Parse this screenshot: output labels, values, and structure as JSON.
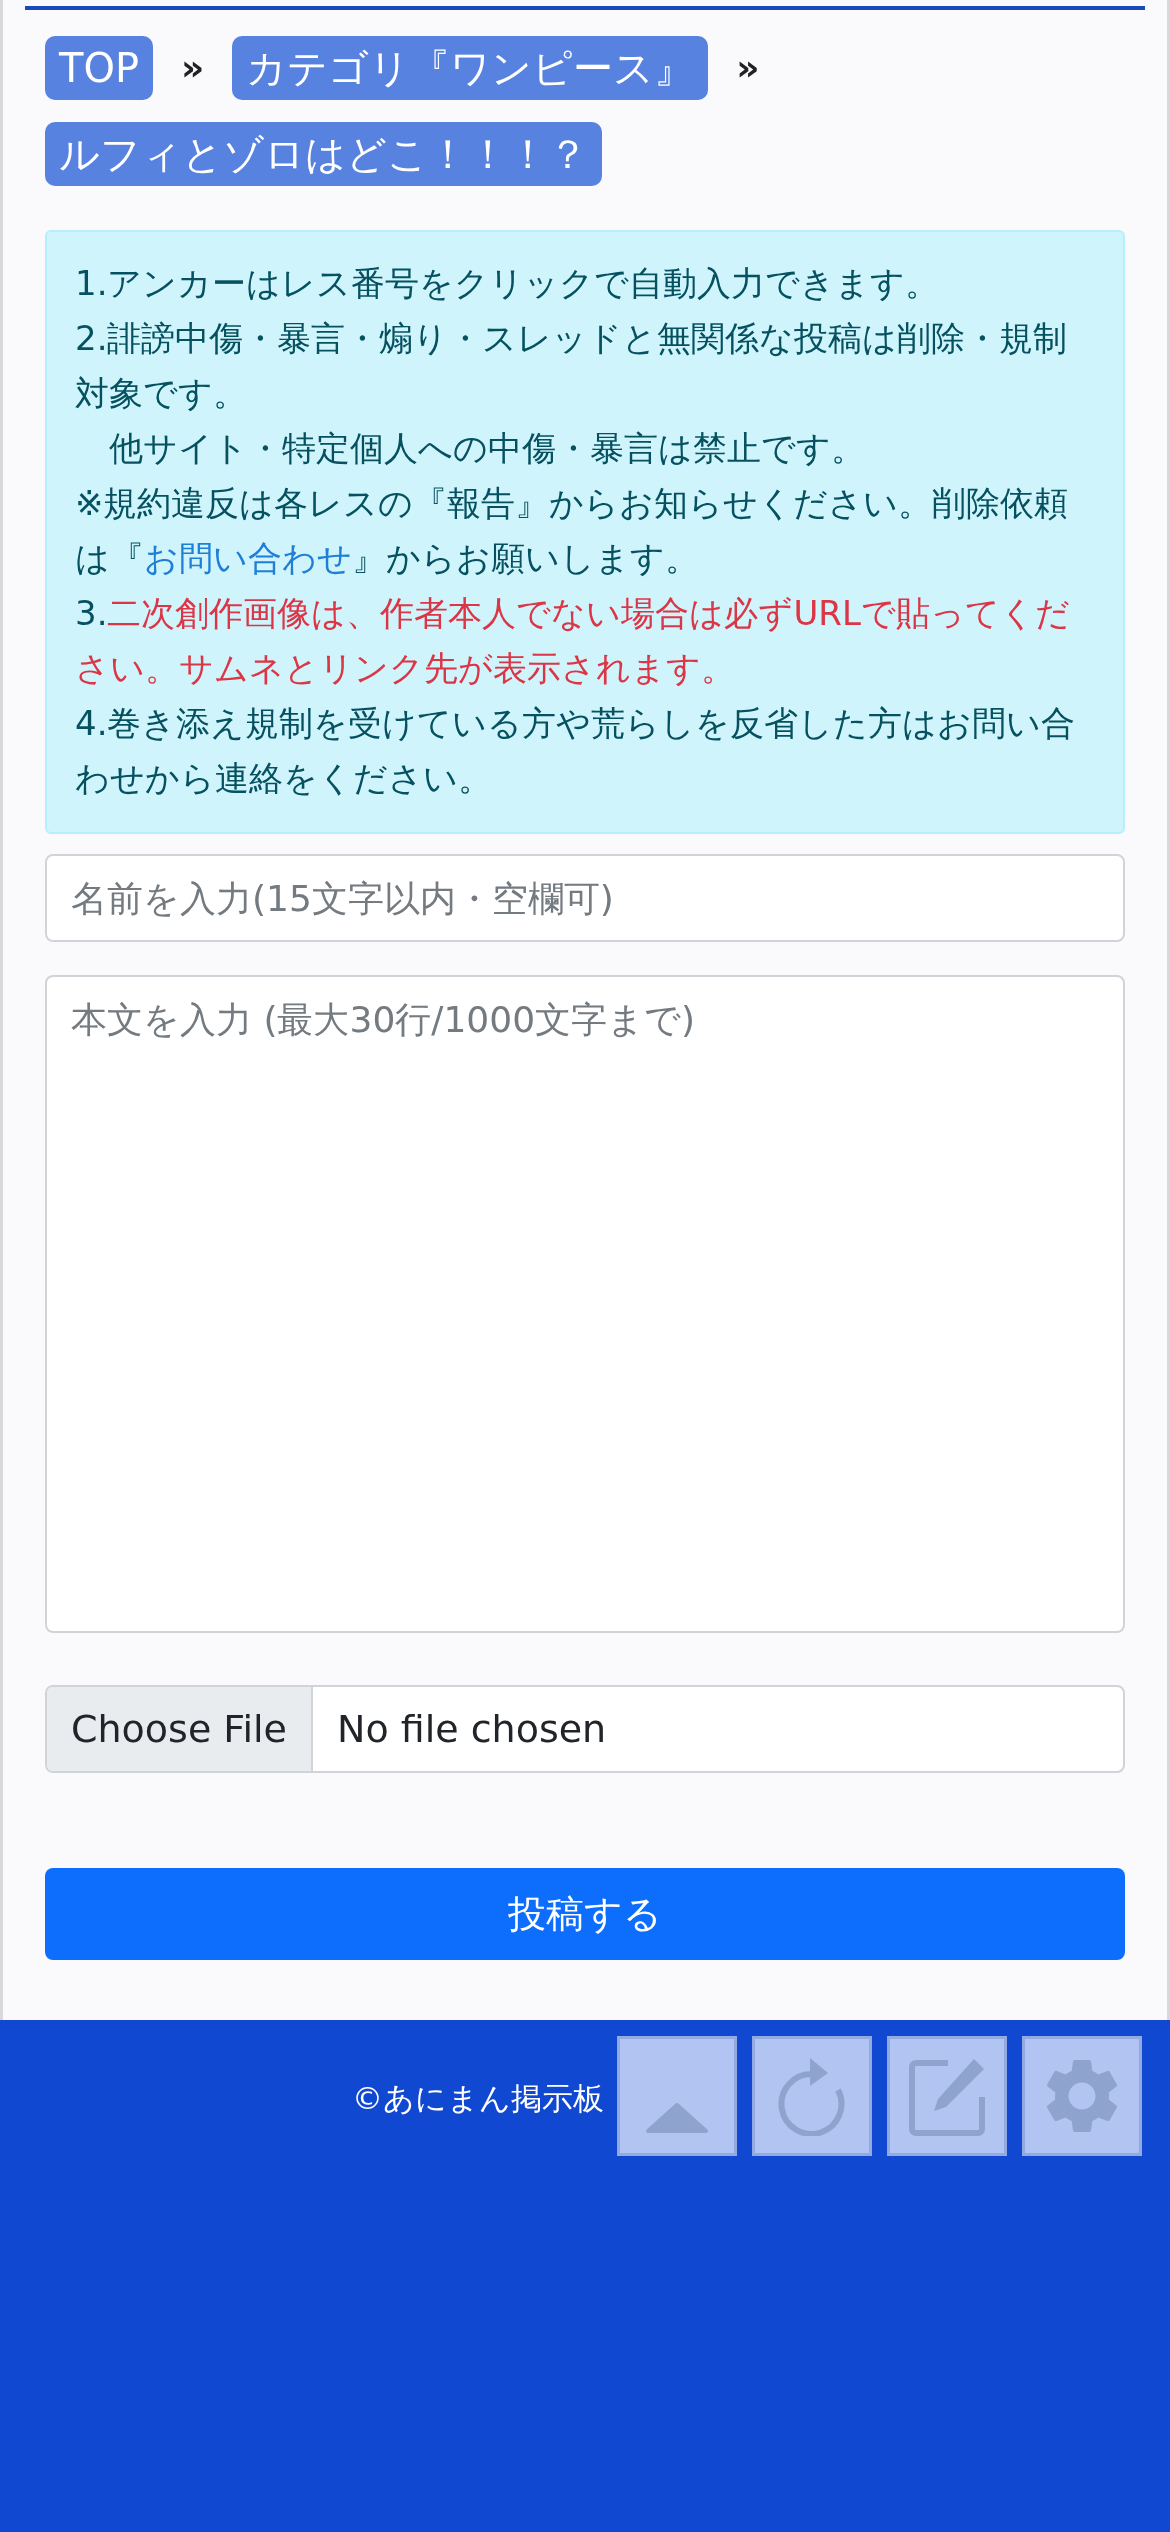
{
  "breadcrumbs": [
    {
      "kind": "link",
      "label": "TOP"
    },
    {
      "kind": "separator",
      "label": "»"
    },
    {
      "kind": "link",
      "label": "カテゴリ『ワンピース』"
    },
    {
      "kind": "separator",
      "label": "»"
    },
    {
      "kind": "link",
      "label": "ルフィとゾロはどこ！！！？"
    }
  ],
  "notice": {
    "lines": [
      [
        {
          "kind": "text",
          "text": "1.アンカーはレス番号をクリックで自動入力できます。"
        }
      ],
      [
        {
          "kind": "text",
          "text": "2.誹謗中傷・暴言・煽り・スレッドと無関係な投稿は削除・規制対象です。"
        }
      ],
      [
        {
          "kind": "text",
          "text": "　他サイト・特定個人への中傷・暴言は禁止です。"
        }
      ],
      [
        {
          "kind": "text",
          "text": "※規約違反は各レスの『報告』からお知らせください。削除依頼は『"
        },
        {
          "kind": "link",
          "text": "お問い合わせ"
        },
        {
          "kind": "text",
          "text": "』からお願いします。"
        }
      ],
      [
        {
          "kind": "text",
          "text": "3."
        },
        {
          "kind": "alert",
          "text": "二次創作画像は、作者本人でない場合は必ずURLで貼ってください。サムネとリンク先が表示されます。"
        }
      ],
      [
        {
          "kind": "text",
          "text": "4.巻き添え規制を受けている方や荒らしを反省した方はお問い合わせから連絡をください。"
        }
      ]
    ]
  },
  "form": {
    "name_placeholder": "名前を入力(15文字以内・空欄可)",
    "body_placeholder": "本文を入力 (最大30行/1000文字まで)",
    "file_button": "Choose File",
    "file_status": "No file chosen",
    "submit": "投稿する"
  },
  "footer": {
    "copyright": "©あにまん掲示板"
  },
  "floating_buttons": [
    {
      "kind": "top"
    },
    {
      "kind": "reload"
    },
    {
      "kind": "write"
    },
    {
      "kind": "settings"
    }
  ]
}
